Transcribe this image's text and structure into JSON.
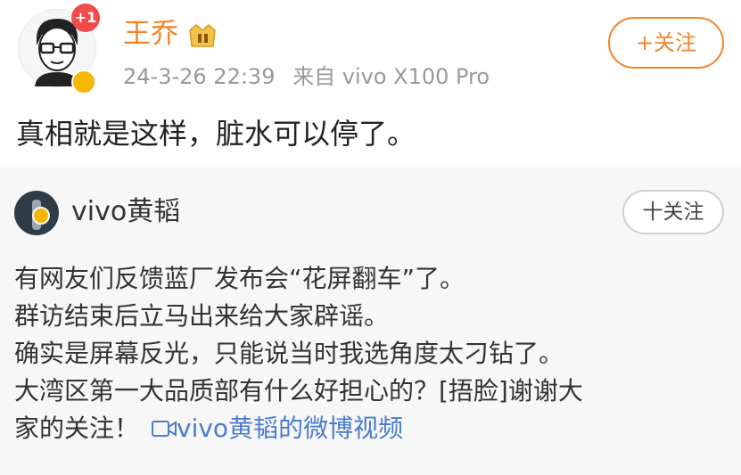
{
  "post": {
    "author_name": "王乔",
    "notification_count": "+1",
    "timestamp": "24-3-26 22:39",
    "source": "来自 vivo X100 Pro",
    "follow_label": "+关注",
    "text": "真相就是这样，脏水可以停了。"
  },
  "repost": {
    "author_name": "vivo黄韬",
    "follow_label": "十关注",
    "lines": [
      "有网友们反馈蓝厂发布会“花屏翻车”了。",
      "群访结束后立马出来给大家辟谣。",
      "确实是屏幕反光，只能说当时我选角度太刁钻了。",
      "大湾区第一大品质部有什么好担心的？[捂脸]谢谢大",
      "家的关注！"
    ],
    "video_link": "vivo黄韬的微博视频"
  },
  "colors": {
    "accent": "#f2832a",
    "link": "#4a7bd0",
    "badge": "#f24b4b",
    "verified": "#f7b500"
  },
  "icons": [
    "avatar",
    "vip-badge-icon",
    "verified-icon",
    "video-icon"
  ]
}
